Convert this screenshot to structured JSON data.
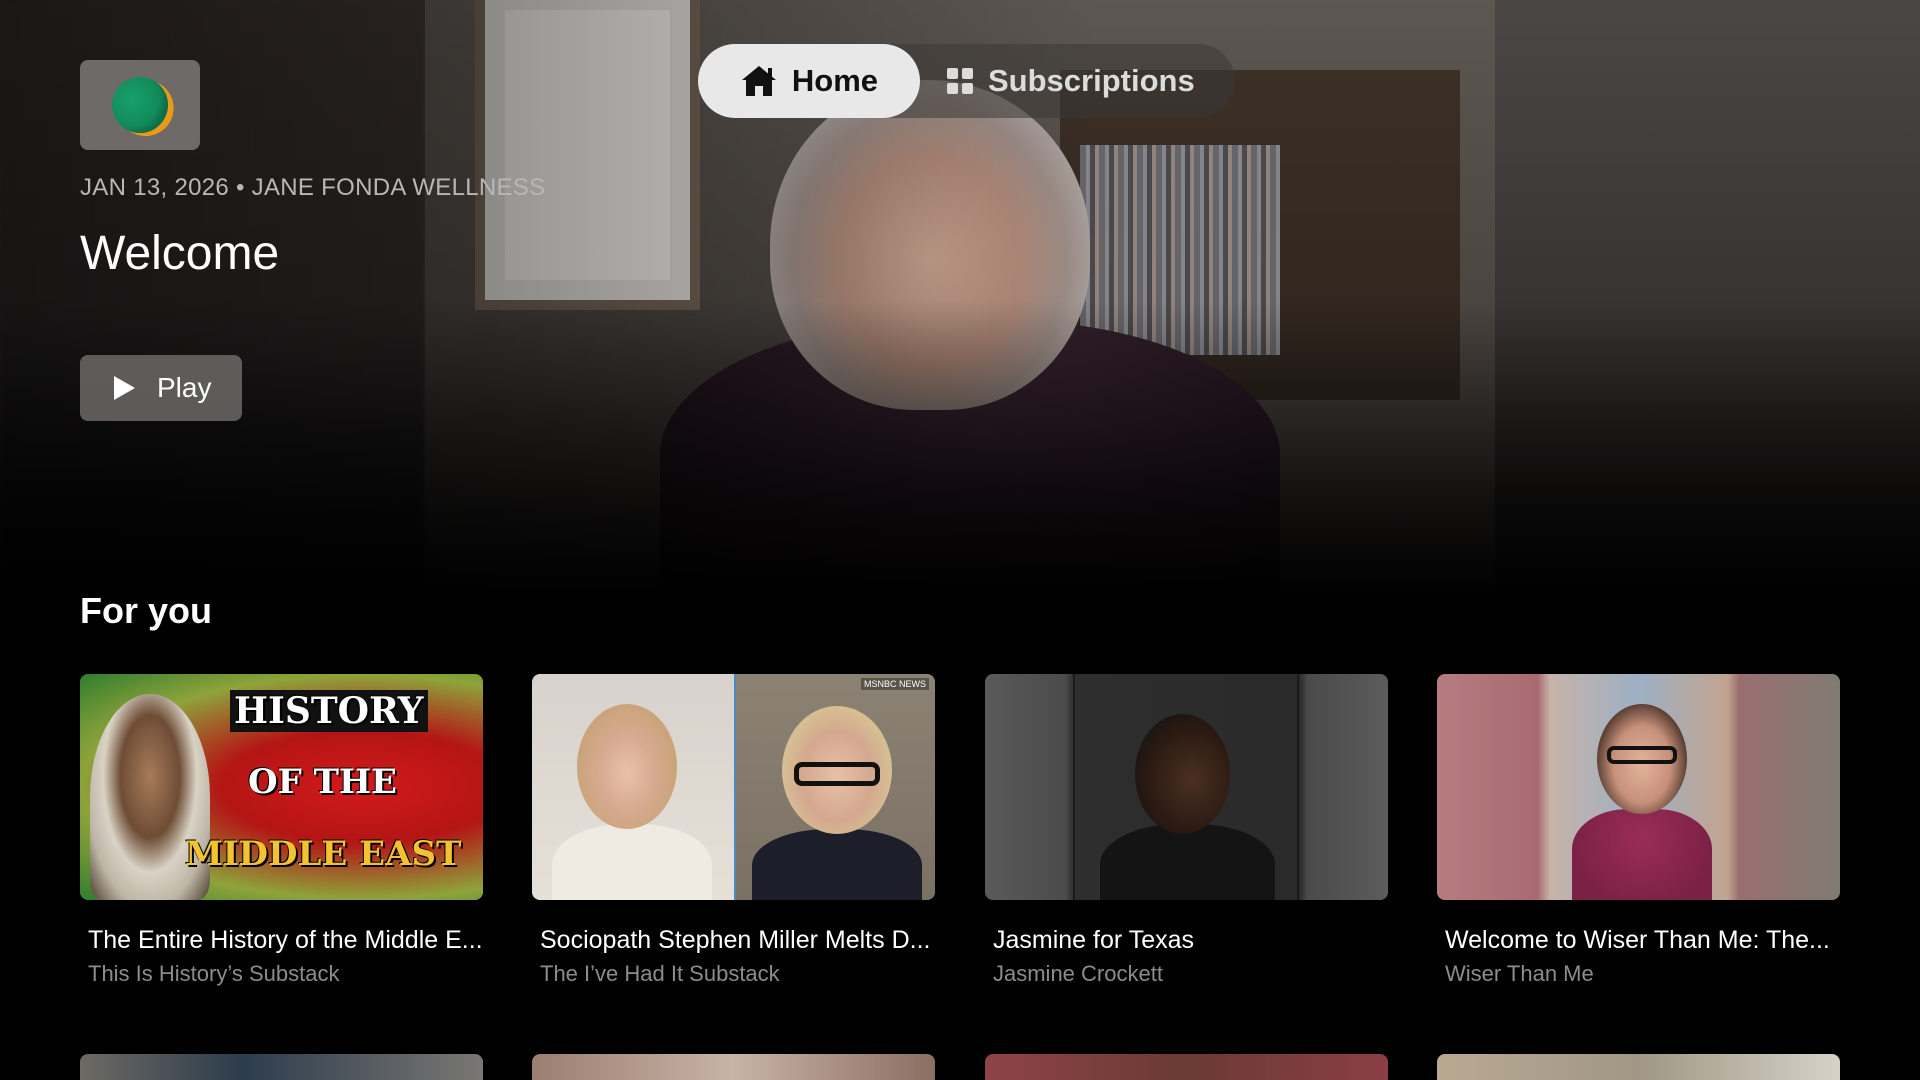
{
  "nav": {
    "tabs": [
      {
        "label": "Home",
        "icon": "home-icon",
        "active": true
      },
      {
        "label": "Subscriptions",
        "icon": "grid-icon",
        "active": false
      }
    ]
  },
  "hero": {
    "channel_logo": "channel-logo",
    "meta": "JAN 13, 2026 • JANE FONDA WELLNESS",
    "title": "Welcome",
    "play_label": "Play"
  },
  "section": {
    "title": "For you"
  },
  "cards": [
    {
      "title": "The Entire History of the Middle E...",
      "subtitle": "This Is History’s Substack",
      "thumb_text": [
        "HISTORY",
        "OF THE",
        "MIDDLE EAST"
      ]
    },
    {
      "title": "Sociopath Stephen Miller Melts D...",
      "subtitle": "The I’ve Had It Substack",
      "thumb_text": [
        "MSNBC NEWS"
      ]
    },
    {
      "title": "Jasmine for Texas",
      "subtitle": "Jasmine Crockett"
    },
    {
      "title": "Welcome to Wiser Than Me: The...",
      "subtitle": "Wiser Than Me"
    }
  ],
  "colors": {
    "background": "#000000",
    "active_tab_bg": "#e8e8e8",
    "subtitle_text": "#8e8c8a",
    "meta_text": "#b9b7b5"
  }
}
